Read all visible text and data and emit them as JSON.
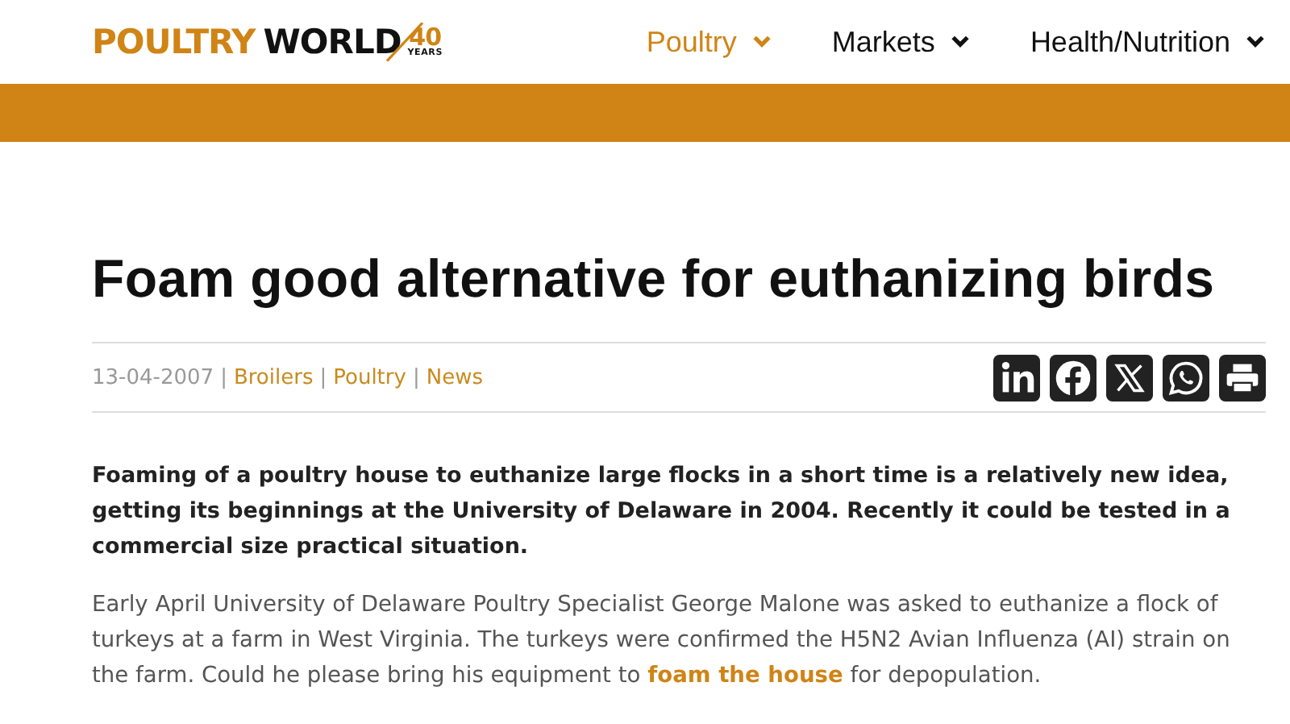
{
  "logo": {
    "part_1": "POULTRY",
    "part_2": "WORLD",
    "anniversary": "40",
    "anniversary_caption": "YEARS"
  },
  "nav": [
    {
      "label": "Poultry",
      "selected": true
    },
    {
      "label": "Markets",
      "selected": false
    },
    {
      "label": "Health/Nutrition",
      "selected": false
    }
  ],
  "article": {
    "title": "Foam good alternative for euthanizing birds",
    "date": "13-04-2007",
    "tags": [
      {
        "separator": "|",
        "label": "Broilers"
      },
      {
        "separator": "|",
        "label": "Poultry"
      },
      {
        "separator": "|",
        "label": "News"
      }
    ],
    "share": [
      {
        "kind": "linkedin"
      },
      {
        "kind": "facebook"
      },
      {
        "kind": "x"
      },
      {
        "kind": "whatsapp"
      },
      {
        "kind": "print"
      }
    ],
    "lead": "Foaming of a poultry house to euthanize large flocks in a short time is a relatively new idea, getting its beginnings at the University of Delaware in 2004. Recently it could be tested in a commercial size practical situation.",
    "body_before_link": "Early April University of Delaware Poultry Specialist George Malone was asked to euthanize a flock of turkeys at a farm in West Virginia. The turkeys were confirmed the H5N2 Avian Influenza (AI) strain on the farm. Could he please bring his equipment to",
    "body_link": "foam the house",
    "body_after_link": "for depopulation."
  }
}
